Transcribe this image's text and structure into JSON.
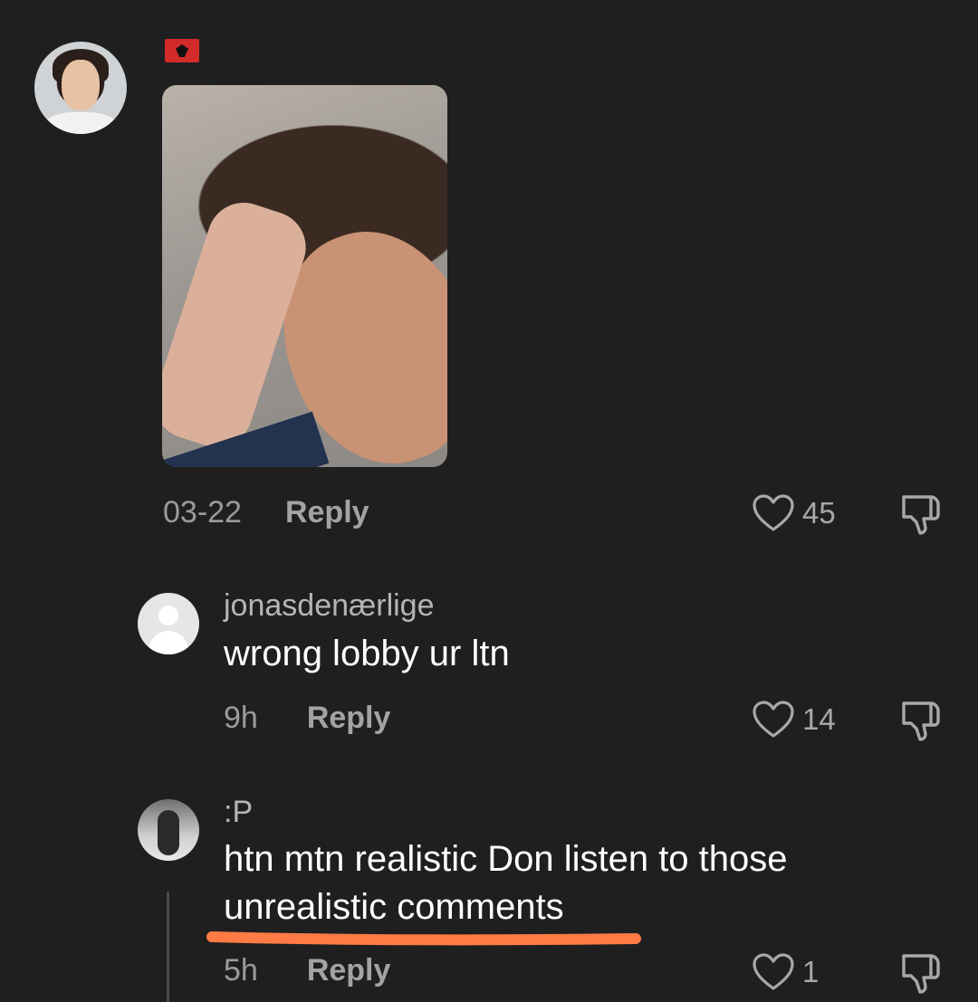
{
  "comment_main": {
    "date": "03-22",
    "reply_label": "Reply",
    "like_count": "45"
  },
  "reply_1": {
    "username": "jonasdenærlige",
    "text": "wrong lobby ur ltn",
    "time": "9h",
    "reply_label": "Reply",
    "like_count": "14"
  },
  "reply_2": {
    "username": ":P",
    "text_line1": "htn mtn realistic Don listen to those",
    "text_line2": "unrealistic comments",
    "time": "5h",
    "reply_label": "Reply",
    "like_count": "1"
  },
  "colors": {
    "background": "#1f1f1f",
    "highlight_underline": "#ff7a45"
  }
}
